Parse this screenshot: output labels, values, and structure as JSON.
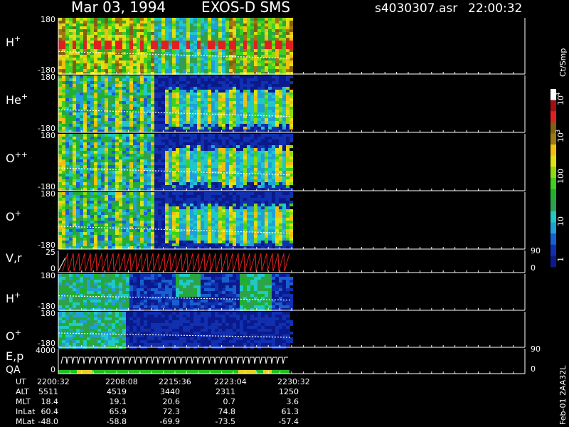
{
  "header": {
    "date": "Mar 03, 1994",
    "instrument": "EXOS-D SMS",
    "filename": "s4030307.asr",
    "time": "22:00:32"
  },
  "colorbar": {
    "unit": "Ct/Smp",
    "labels": [
      "1",
      "10",
      "100",
      "10",
      "10"
    ],
    "superscripts": [
      "",
      "",
      "",
      "3",
      "4"
    ],
    "scale": "log",
    "range": [
      1,
      10000
    ]
  },
  "colors": {
    "background": "#000000",
    "foreground": "#ffffff",
    "pitch_red": "#e02020",
    "qa_green": "#20c020",
    "qa_yellow": "#e8d020"
  },
  "chart_data": {
    "type": "heatmap",
    "panels": [
      {
        "label": "H",
        "sup": "+",
        "ymax": "180",
        "ymin": "-180"
      },
      {
        "label": "He",
        "sup": "+",
        "ymax": "180",
        "ymin": "-180"
      },
      {
        "label": "O",
        "sup": "++",
        "ymax": "180",
        "ymin": "-180"
      },
      {
        "label": "O",
        "sup": "+",
        "ymax": "180",
        "ymin": "-180"
      },
      {
        "label": "V,r",
        "sup": "",
        "ymax": "25",
        "ymin": "0",
        "right_top": "90",
        "right_bottom": "0"
      },
      {
        "label": "H",
        "sup": "+",
        "ymax": "180",
        "ymin": "-180"
      },
      {
        "label": "O",
        "sup": "+",
        "ymax": "180",
        "ymin": "-180"
      },
      {
        "label": "E,p",
        "label2": "QA",
        "ymax": "4000",
        "ymin": "0",
        "right_top": "90",
        "right_bottom": "0"
      }
    ],
    "ephemeris": {
      "row_labels": [
        "UT",
        "ALT",
        "MLT",
        "InLat",
        "MLat"
      ],
      "columns": [
        [
          "2200:32",
          "5511",
          "18.4",
          "60.4",
          "-48.0"
        ],
        [
          "2208:08",
          "4519",
          "19.1",
          "65.9",
          "-58.8"
        ],
        [
          "2215:36",
          "3440",
          "20.6",
          "72.3",
          "-69.9"
        ],
        [
          "2223:04",
          "2311",
          "0.7",
          "74.8",
          "-73.5"
        ],
        [
          "2230:32",
          "1250",
          "3.6",
          "61.3",
          "-57.4"
        ]
      ]
    },
    "version_label": "Feb-01 2AA32L"
  }
}
